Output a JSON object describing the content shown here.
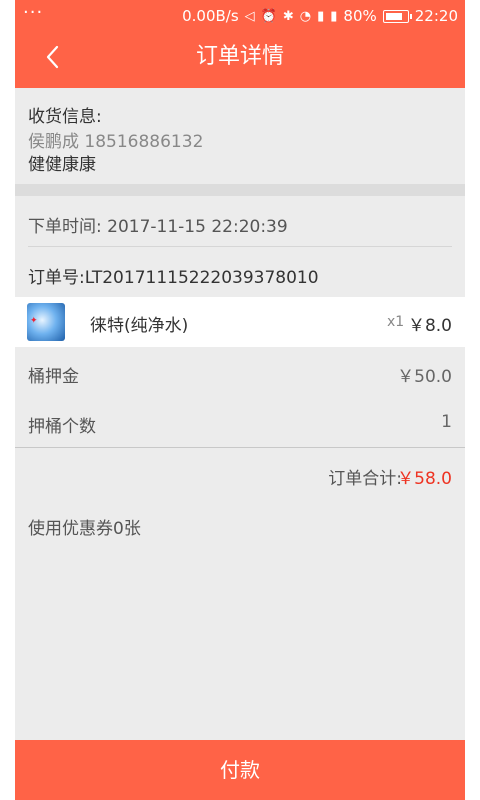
{
  "status_bar": {
    "dots": "···",
    "speed": "0.00B/s",
    "battery": "80%",
    "time": "22:20"
  },
  "header": {
    "title": "订单详情",
    "back_icon": "chevron-left-icon"
  },
  "address": {
    "label": "收货信息:",
    "name_phone": "侯鹏成 18516886132",
    "address_line": "健健康康"
  },
  "order": {
    "time_label": "下单时间: 2017-11-15 22:20:39",
    "number_label": "订单号:LT20171115222039378010"
  },
  "product": {
    "name": "徕特(纯净水)",
    "qty": "x1",
    "price": "￥8.0"
  },
  "fees": {
    "deposit_label": "桶押金",
    "deposit_value": "￥50.0",
    "count_label": "押桶个数",
    "count_value": "1"
  },
  "total": {
    "label": "订单合计:",
    "value": "￥58.0"
  },
  "coupon": {
    "label": "使用优惠券0张"
  },
  "footer": {
    "pay_label": "付款"
  },
  "colors": {
    "accent": "#ff6347",
    "price_red": "#e32222"
  }
}
